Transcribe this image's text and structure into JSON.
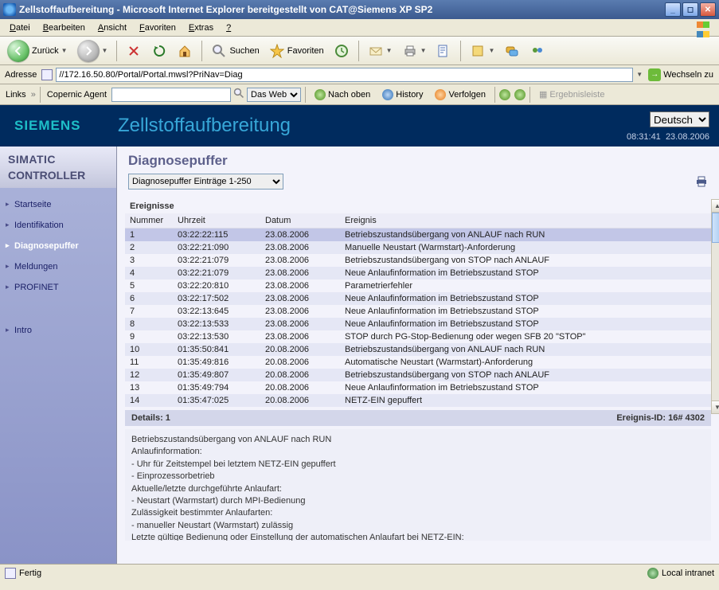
{
  "window": {
    "title": "Zellstoffaufbereitung - Microsoft Internet Explorer bereitgestellt von CAT@Siemens XP SP2"
  },
  "menu": {
    "items": [
      "Datei",
      "Bearbeiten",
      "Ansicht",
      "Favoriten",
      "Extras",
      "?"
    ]
  },
  "toolbar": {
    "back": "Zurück",
    "search": "Suchen",
    "favorites": "Favoriten"
  },
  "address": {
    "label": "Adresse",
    "url": "//172.16.50.80/Portal/Portal.mwsl?PriNav=Diag",
    "go": "Wechseln zu"
  },
  "linksbar": {
    "links": "Links",
    "copernic": "Copernic Agent",
    "scope": "Das Web",
    "nachoben": "Nach oben",
    "history": "History",
    "verfolgen": "Verfolgen",
    "ergebnis": "Ergebnisleiste"
  },
  "header": {
    "brand": "SIEMENS",
    "title": "Zellstoffaufbereitung",
    "language": "Deutsch",
    "time": "08:31:41",
    "date": "23.08.2006"
  },
  "sidebar": {
    "title1": "SIMATIC",
    "title2": "CONTROLLER",
    "items": [
      "Startseite",
      "Identifikation",
      "Diagnosepuffer",
      "Meldungen",
      "PROFINET",
      "Intro"
    ],
    "activeIndex": 2
  },
  "main": {
    "title": "Diagnosepuffer",
    "filter": "Diagnosepuffer Einträge 1-250",
    "eventsLabel": "Ereignisse",
    "columns": [
      "Nummer",
      "Uhrzeit",
      "Datum",
      "Ereignis"
    ],
    "rows": [
      {
        "n": "1",
        "t": "03:22:22:115",
        "d": "23.08.2006",
        "e": "Betriebszustandsübergang von ANLAUF nach RUN"
      },
      {
        "n": "2",
        "t": "03:22:21:090",
        "d": "23.08.2006",
        "e": "Manuelle Neustart (Warmstart)-Anforderung"
      },
      {
        "n": "3",
        "t": "03:22:21:079",
        "d": "23.08.2006",
        "e": "Betriebszustandsübergang von STOP nach ANLAUF"
      },
      {
        "n": "4",
        "t": "03:22:21:079",
        "d": "23.08.2006",
        "e": "Neue Anlaufinformation im Betriebszustand STOP"
      },
      {
        "n": "5",
        "t": "03:22:20:810",
        "d": "23.08.2006",
        "e": "Parametrierfehler"
      },
      {
        "n": "6",
        "t": "03:22:17:502",
        "d": "23.08.2006",
        "e": "Neue Anlaufinformation im Betriebszustand STOP"
      },
      {
        "n": "7",
        "t": "03:22:13:645",
        "d": "23.08.2006",
        "e": "Neue Anlaufinformation im Betriebszustand STOP"
      },
      {
        "n": "8",
        "t": "03:22:13:533",
        "d": "23.08.2006",
        "e": "Neue Anlaufinformation im Betriebszustand STOP"
      },
      {
        "n": "9",
        "t": "03:22:13:530",
        "d": "23.08.2006",
        "e": "STOP durch PG-Stop-Bedienung oder wegen SFB 20 \"STOP\""
      },
      {
        "n": "10",
        "t": "01:35:50:841",
        "d": "20.08.2006",
        "e": "Betriebszustandsübergang von ANLAUF nach RUN"
      },
      {
        "n": "11",
        "t": "01:35:49:816",
        "d": "20.08.2006",
        "e": "Automatische Neustart (Warmstart)-Anforderung"
      },
      {
        "n": "12",
        "t": "01:35:49:807",
        "d": "20.08.2006",
        "e": "Betriebszustandsübergang von STOP nach ANLAUF"
      },
      {
        "n": "13",
        "t": "01:35:49:794",
        "d": "20.08.2006",
        "e": "Neue Anlaufinformation im Betriebszustand STOP"
      },
      {
        "n": "14",
        "t": "01:35:47:025",
        "d": "20.08.2006",
        "e": "NETZ-EIN gepuffert"
      }
    ],
    "detailsLabel": "Details: 1",
    "eventIdLabel": "Ereignis-ID: 16# 4302",
    "details": [
      "Betriebszustandsübergang von ANLAUF nach RUN",
      "Anlaufinformation:",
      "- Uhr für Zeitstempel bei letztem NETZ-EIN gepuffert",
      "- Einprozessorbetrieb",
      "Aktuelle/letzte durchgeführte Anlaufart:",
      "- Neustart (Warmstart) durch MPI-Bedienung",
      "Zulässigkeit bestimmter Anlaufarten:",
      "- manueller Neustart (Warmstart) zulässig",
      "Letzte gültige Bedienung oder Einstellung der automatischen Anlaufart bei NETZ-EIN:"
    ]
  },
  "status": {
    "left": "Fertig",
    "right": "Local intranet"
  }
}
